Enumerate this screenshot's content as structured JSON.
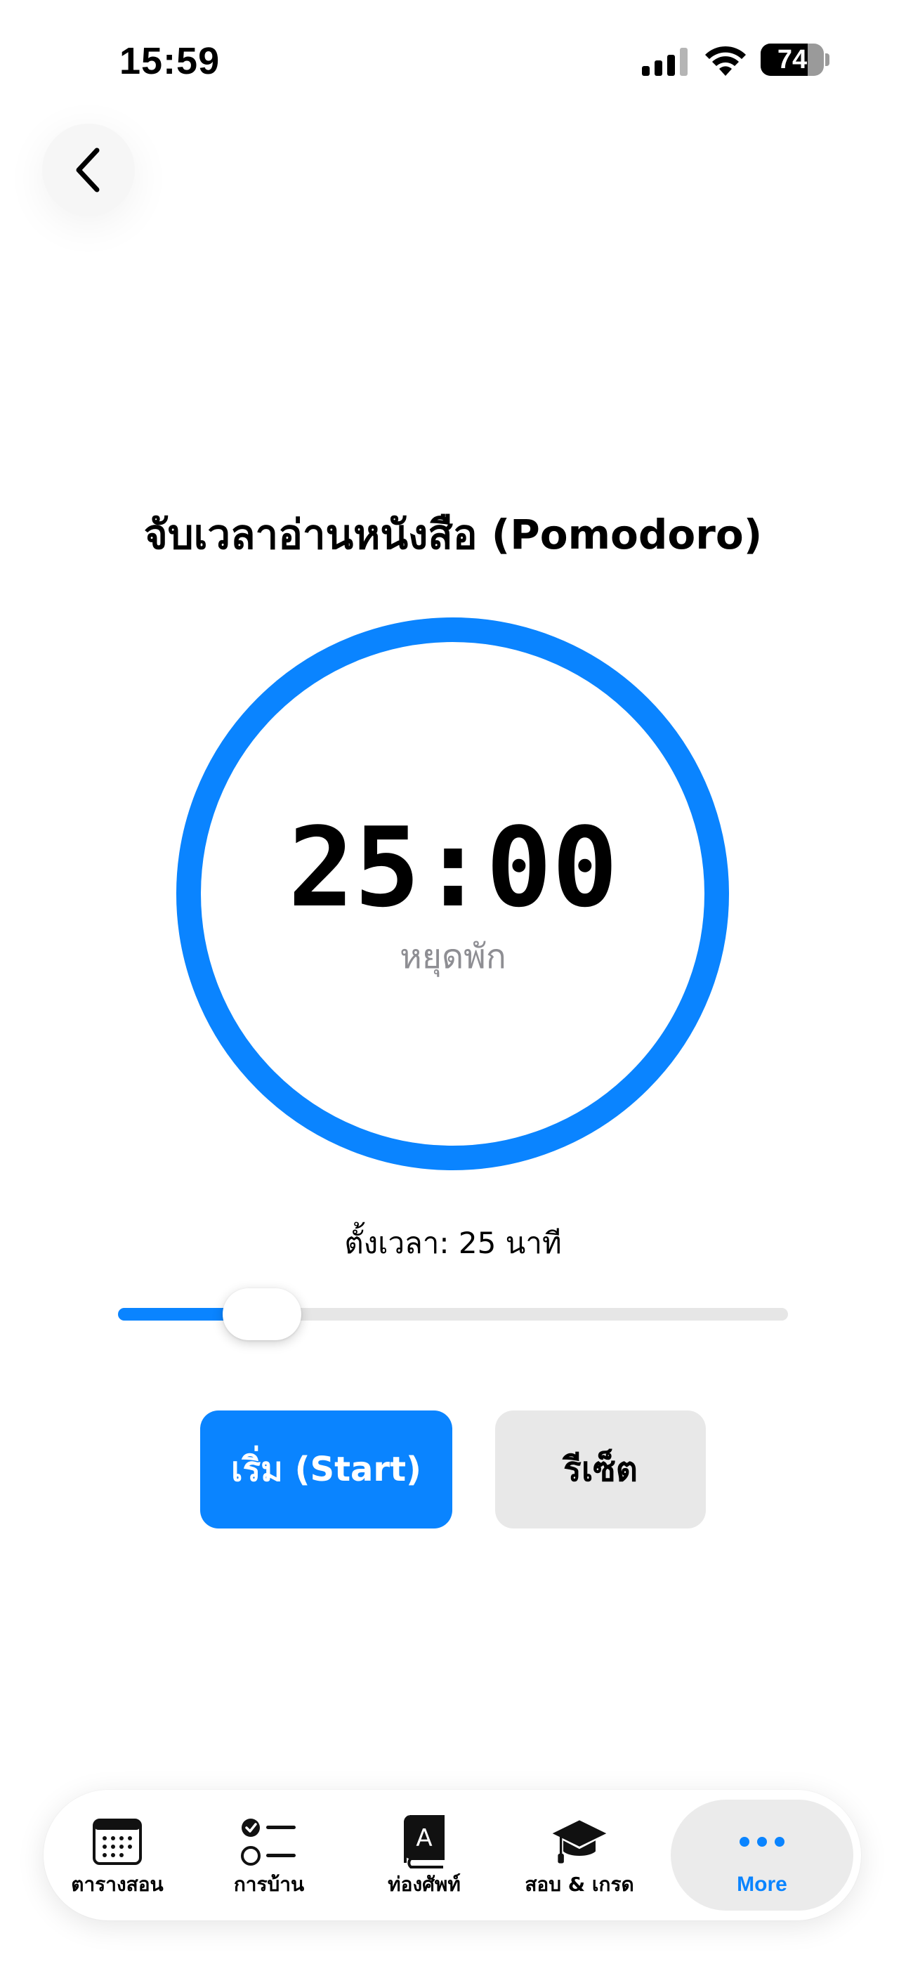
{
  "status_bar": {
    "time": "15:59",
    "battery_text": "74",
    "battery_level": 0.74
  },
  "header": {
    "back_icon": "chevron-left-icon"
  },
  "title": "จับเวลาอ่านหนังสือ (Pomodoro)",
  "timer": {
    "value": "25:00",
    "status": "หยุดพัก",
    "progress": 1.0,
    "ring_color": "#0A84FF"
  },
  "slider": {
    "label": "ตั้งเวลา: 25 นาที",
    "value_minutes": 25,
    "fraction": 0.215,
    "accent": "#0A84FF"
  },
  "buttons": {
    "start_label": "เริ่ม (Start)",
    "reset_label": "รีเซ็ต"
  },
  "tabbar": {
    "selected_index": 4,
    "items": [
      {
        "label": "ตารางสอน",
        "icon": "calendar-icon"
      },
      {
        "label": "การบ้าน",
        "icon": "checklist-icon"
      },
      {
        "label": "ท่องศัพท์",
        "icon": "dictionary-icon"
      },
      {
        "label": "สอบ & เกรด",
        "icon": "graduation-cap-icon"
      },
      {
        "label": "More",
        "icon": "more-dots-icon"
      }
    ]
  }
}
